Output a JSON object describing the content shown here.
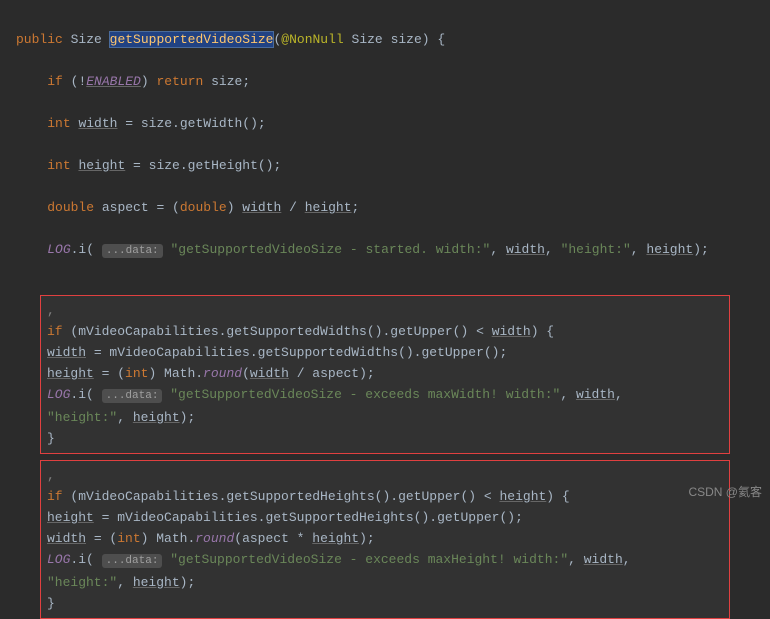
{
  "sig": {
    "modifier": "public",
    "returnType": "Size",
    "methodName": "getSupportedVideoSize",
    "annotation": "@NonNull",
    "paramType": "Size",
    "paramName": "size",
    "brace": "{"
  },
  "l1": {
    "kw_if": "if",
    "open": "(!",
    "enabled": "ENABLED",
    "close": ")",
    "ret": "return",
    "var": "size",
    "semi": ";"
  },
  "l2": {
    "kw_int": "int",
    "var": "width",
    "eq": " = size.getWidth();"
  },
  "l3": {
    "kw_int": "int",
    "var": "height",
    "eq": " = size.getHeight();"
  },
  "l4": {
    "kw_double": "double",
    "var": "aspect",
    "eq": " = (",
    "cast": "double",
    "close": ") ",
    "w": "width",
    "op": " / ",
    "h": "height",
    "semi": ";"
  },
  "l5": {
    "log": "LOG",
    "dot": ".i( ",
    "hint": "...data:",
    "sp": " ",
    "s1": "\"getSupportedVideoSize - started. width:\"",
    "c1": ", ",
    "w": "width",
    "c2": ", ",
    "s2": "\"height:\"",
    "c3": ", ",
    "h": "height",
    "end": ");"
  },
  "box1": {
    "c1": ", ",
    "if_kw": "if",
    "if_open": " (mVideoCapabilities.getSupportedWidths().getUpper() < ",
    "if_var": "width",
    "if_close": ") {",
    "a1_var": "width",
    "a1_rest": " = mVideoCapabilities.getSupportedWidths().getUpper();",
    "a2_var": "height",
    "a2_eq": " = (",
    "a2_cast": "int",
    "a2_math": ") Math.",
    "a2_round": "round",
    "a2_open": "(",
    "a2_w": "width",
    "a2_rest": " / aspect);",
    "log": "LOG",
    "log_dot": ".i( ",
    "hint": "...data:",
    "sp": " ",
    "s1": "\"getSupportedVideoSize - exceeds maxWidth! width:\"",
    "w": "width",
    "comma": ",",
    "s2": "\"height:\"",
    "c2": ", ",
    "h": "height",
    "end": ");",
    "close": "}"
  },
  "box2": {
    "c1": ", ",
    "if_kw": "if",
    "if_open": " (mVideoCapabilities.getSupportedHeights().getUpper() < ",
    "if_var": "height",
    "if_close": ") {",
    "a1_var": "height",
    "a1_rest": " = mVideoCapabilities.getSupportedHeights().getUpper();",
    "a2_var": "width",
    "a2_eq": " = (",
    "a2_cast": "int",
    "a2_math": ") Math.",
    "a2_round": "round",
    "a2_open": "(aspect * ",
    "a2_h": "height",
    "a2_rest": ");",
    "log": "LOG",
    "log_dot": ".i( ",
    "hint": "...data:",
    "sp": " ",
    "s1": "\"getSupportedVideoSize - exceeds maxHeight! width:\"",
    "w": "width",
    "comma": ",",
    "s2": "\"height:\"",
    "c2": ", ",
    "h": "height",
    "end": ");",
    "close": "}"
  },
  "watermark": "CSDN @氦客"
}
